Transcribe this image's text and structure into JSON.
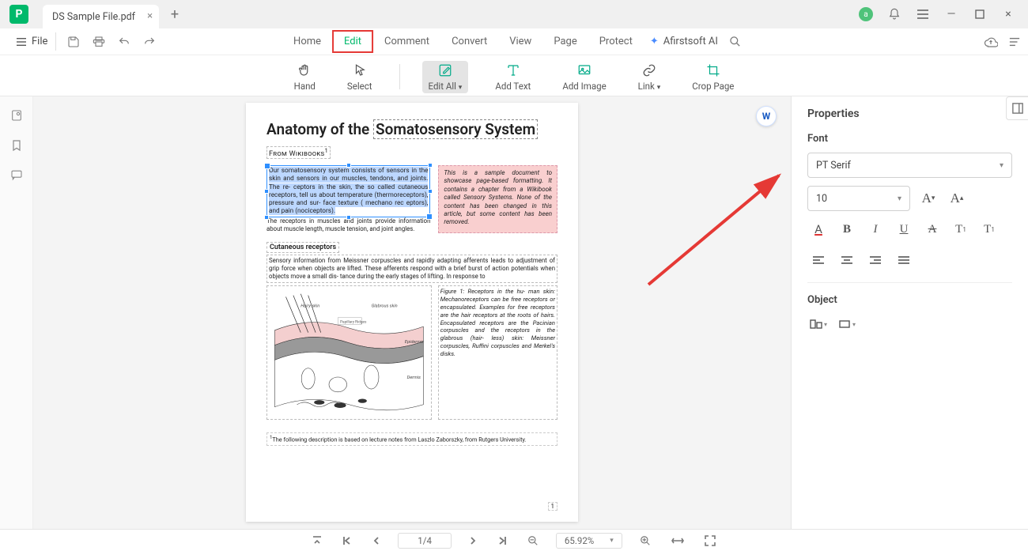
{
  "titlebar": {
    "tab_title": "DS Sample File.pdf",
    "avatar_letter": "a"
  },
  "menubar": {
    "file": "File",
    "items": [
      "Home",
      "Edit",
      "Comment",
      "Convert",
      "View",
      "Page",
      "Protect"
    ],
    "active_index": 1,
    "ai_label": "Afirstsoft AI"
  },
  "toolbar": {
    "hand": "Hand",
    "select": "Select",
    "edit_all": "Edit All",
    "add_text": "Add Text",
    "add_image": "Add Image",
    "link": "Link",
    "crop": "Crop Page"
  },
  "properties": {
    "title": "Properties",
    "font_section": "Font",
    "font_family": "PT Serif",
    "font_size": "10",
    "object_section": "Object"
  },
  "document": {
    "title_a": "Anatomy of the ",
    "title_b": "Somatosensory System",
    "from": "From Wikibooks",
    "selected_text": "Our somatosensory system consists of  sensors in the skin  and sensors in our  muscles, tendons,  and  joints. The re-  ceptors in the skin, the so  called cutaneous receptors,  tell  us about temperature (thermoreceptors),  pressure and sur-  face texture ( mechano  rec eptors),  and pain (nociceptors).",
    "below_selected": "The receptors in muscles and joints provide information about muscle length, muscle   tension, and joint angles.",
    "pink_note": "This is a sample document to showcase page-based formatting. It contains a chapter from a Wikibook called Sensory Systems. None of the content has been changed in this article, but some content has been removed.",
    "subhead": "Cutaneous receptors",
    "para2": "Sensory information from Meissner corpuscles and rapidly adapting afferents leads to adjustment of grip force when objects are lifted. These afferents respond with a brief burst of action potentials when objects move a small dis- tance during the early stages of lifting.  In response to",
    "fig_caption": "Figure 1:  Receptors in the hu- man skin: Mechanoreceptors can be free receptors or encapsulated. Examples for free receptors are the hair receptors at the roots of hairs. Encapsulated receptors are the Pacinian corpuscles and the receptors in the glabrous (hair- less) skin: Meissner corpuscles, Ruffini corpuscles and Merkel's disks.",
    "footnote": "The following description is based on lecture notes from Laszlo Zaborszky, from Rutgers University.",
    "page_number": "1"
  },
  "statusbar": {
    "page_indicator": "1/4",
    "zoom": "65.92%"
  }
}
